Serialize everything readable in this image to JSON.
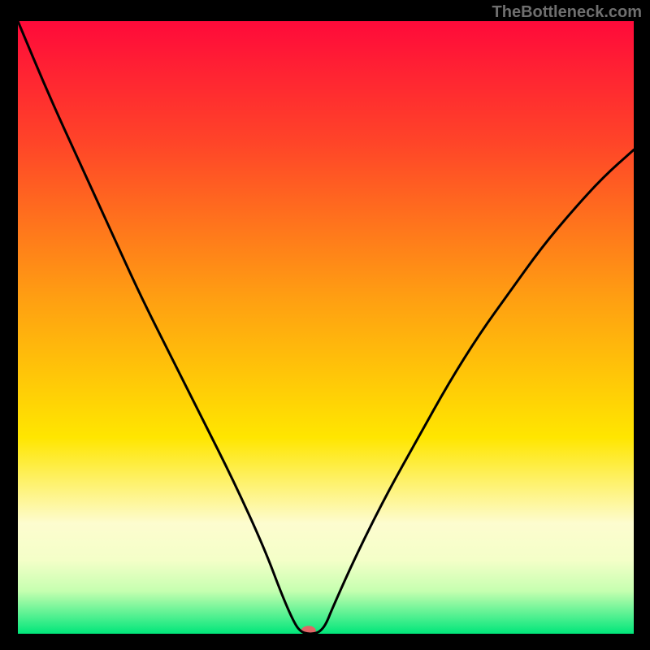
{
  "attribution": "TheBottleneck.com",
  "chart_data": {
    "type": "line",
    "title": "",
    "xlabel": "",
    "ylabel": "",
    "xlim": [
      0,
      100
    ],
    "ylim": [
      0,
      100
    ],
    "gradient_stops": [
      {
        "offset": 0,
        "color": "#ff0a3a"
      },
      {
        "offset": 20,
        "color": "#ff4528"
      },
      {
        "offset": 45,
        "color": "#ff9e12"
      },
      {
        "offset": 68,
        "color": "#ffe600"
      },
      {
        "offset": 82,
        "color": "#fdfccf"
      },
      {
        "offset": 88,
        "color": "#f4ffc8"
      },
      {
        "offset": 93,
        "color": "#c6ffb0"
      },
      {
        "offset": 100,
        "color": "#00e67a"
      }
    ],
    "series": [
      {
        "name": "bottleneck-curve",
        "color": "#000000",
        "x": [
          0,
          5,
          10,
          15,
          20,
          25,
          30,
          35,
          40,
          43,
          45,
          46,
          47,
          48,
          49,
          50,
          51,
          55,
          60,
          65,
          70,
          75,
          80,
          85,
          90,
          95,
          100
        ],
        "y": [
          100,
          88,
          77,
          66,
          55,
          45,
          35,
          25,
          14,
          6,
          1.5,
          0.3,
          0,
          0,
          0.3,
          1.5,
          4,
          13,
          23,
          32,
          41,
          49,
          56,
          63,
          69,
          74.5,
          79
        ]
      }
    ],
    "marker": {
      "x": 47.2,
      "y": 0.5,
      "color": "#e06666",
      "rx": 9,
      "ry": 6
    }
  }
}
